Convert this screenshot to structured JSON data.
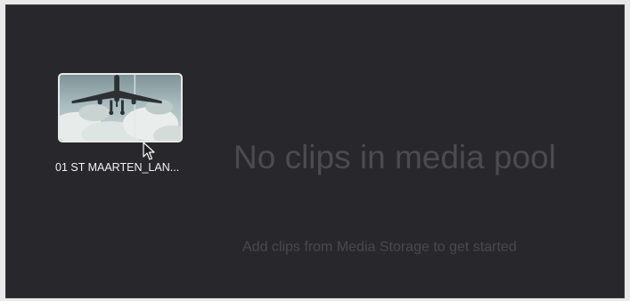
{
  "media_pool": {
    "clips": [
      {
        "name": "01 ST MAARTEN_LAN...",
        "thumbnail": "airplane-landing-thumbnail"
      }
    ],
    "empty_state": {
      "title": "No clips in media pool",
      "subtitle": "Add clips from Media Storage to get started"
    }
  },
  "colors": {
    "panel_background": "#28272b",
    "empty_text": "#4c4b51",
    "thumbnail_border": "#e8e8e8",
    "clip_name": "#f2f2f2"
  },
  "icons": {
    "cursor": "pointer-cursor-icon"
  }
}
